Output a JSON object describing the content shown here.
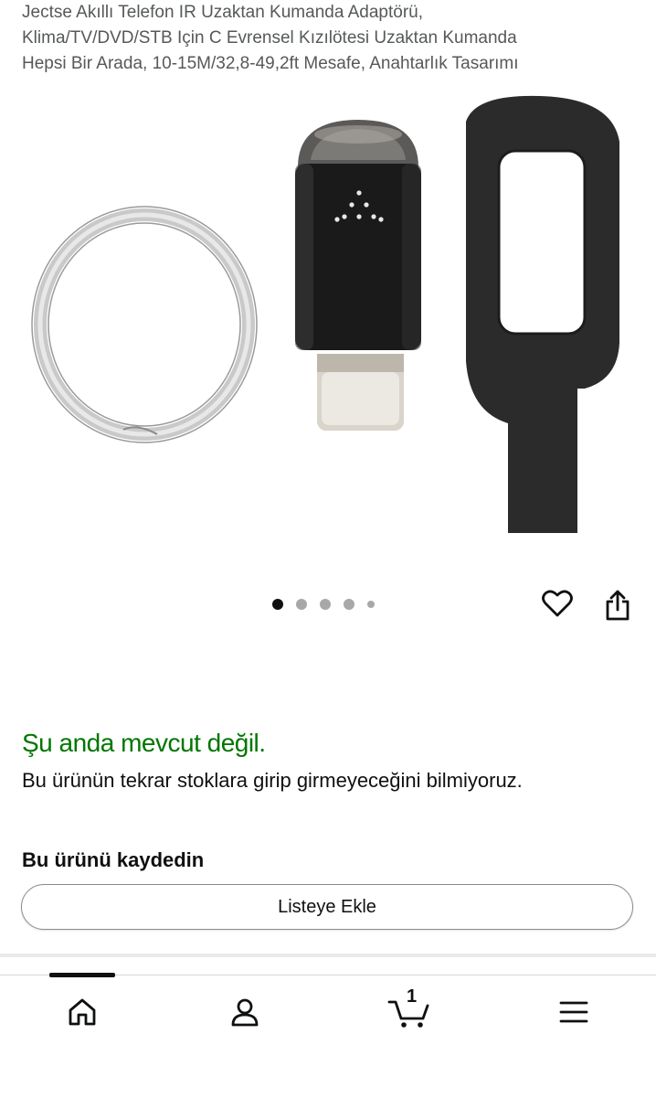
{
  "product": {
    "title": "Jectse Akıllı Telefon IR Uzaktan Kumanda Adaptörü,\nKlima/TV/DVD/STB Için C Evrensel Kızılötesi Uzaktan Kumanda\nHepsi Bir Arada, 10-15M/32,8-49,2ft Mesafe, Anahtarlık Tasarımı"
  },
  "gallery": {
    "image_count": 5,
    "active_index": 0,
    "icons": [
      "keyring-image",
      "ir-adapter-image",
      "silicone-cover-image"
    ]
  },
  "actions": {
    "wishlist_icon": "heart-icon",
    "share_icon": "share-icon"
  },
  "availability": {
    "status": "Şu anda mevcut değil.",
    "description": "Bu ürünün tekrar stoklara girip girmeyeceğini bilmiyoruz.",
    "status_color": "#007600"
  },
  "save": {
    "heading": "Bu ürünü kaydedin",
    "button_label": "Listeye Ekle"
  },
  "bottom_nav": {
    "items": [
      {
        "icon": "home-icon",
        "active": true
      },
      {
        "icon": "account-icon"
      },
      {
        "icon": "cart-icon",
        "count": "1"
      },
      {
        "icon": "menu-icon"
      }
    ]
  }
}
